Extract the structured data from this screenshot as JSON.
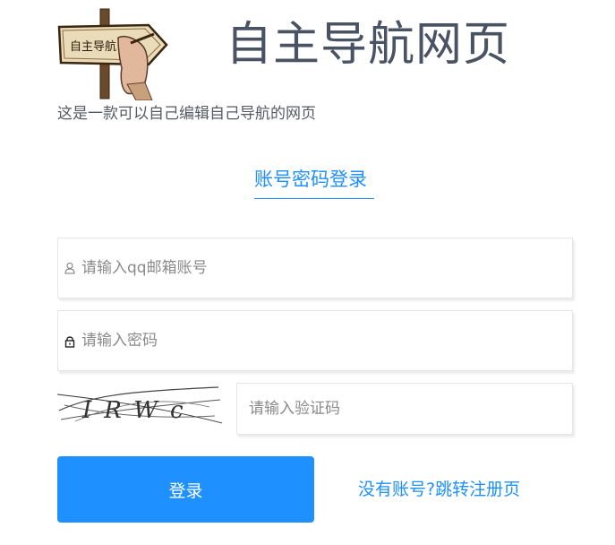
{
  "header": {
    "logo_icon": "signpost-pointing-hand-logo",
    "logo_text": "自主导航",
    "title": "自主导航网页",
    "subtitle": "这是一款可以自己编辑自己导航的网页"
  },
  "login_tabs": [
    {
      "label": "账号密码登录",
      "active": true
    }
  ],
  "form": {
    "account": {
      "icon": "user-icon",
      "placeholder": "请输入qq邮箱账号",
      "value": ""
    },
    "password": {
      "icon": "lock-icon",
      "placeholder": "请输入密码",
      "value": ""
    },
    "captcha": {
      "image_text": "IRWc",
      "placeholder": "请输入验证码",
      "value": ""
    },
    "submit_label": "登录",
    "register_link": "没有账号?跳转注册页"
  },
  "colors": {
    "accent": "#1e90ff",
    "title_text": "#4a5364",
    "body_text": "#555a66"
  }
}
